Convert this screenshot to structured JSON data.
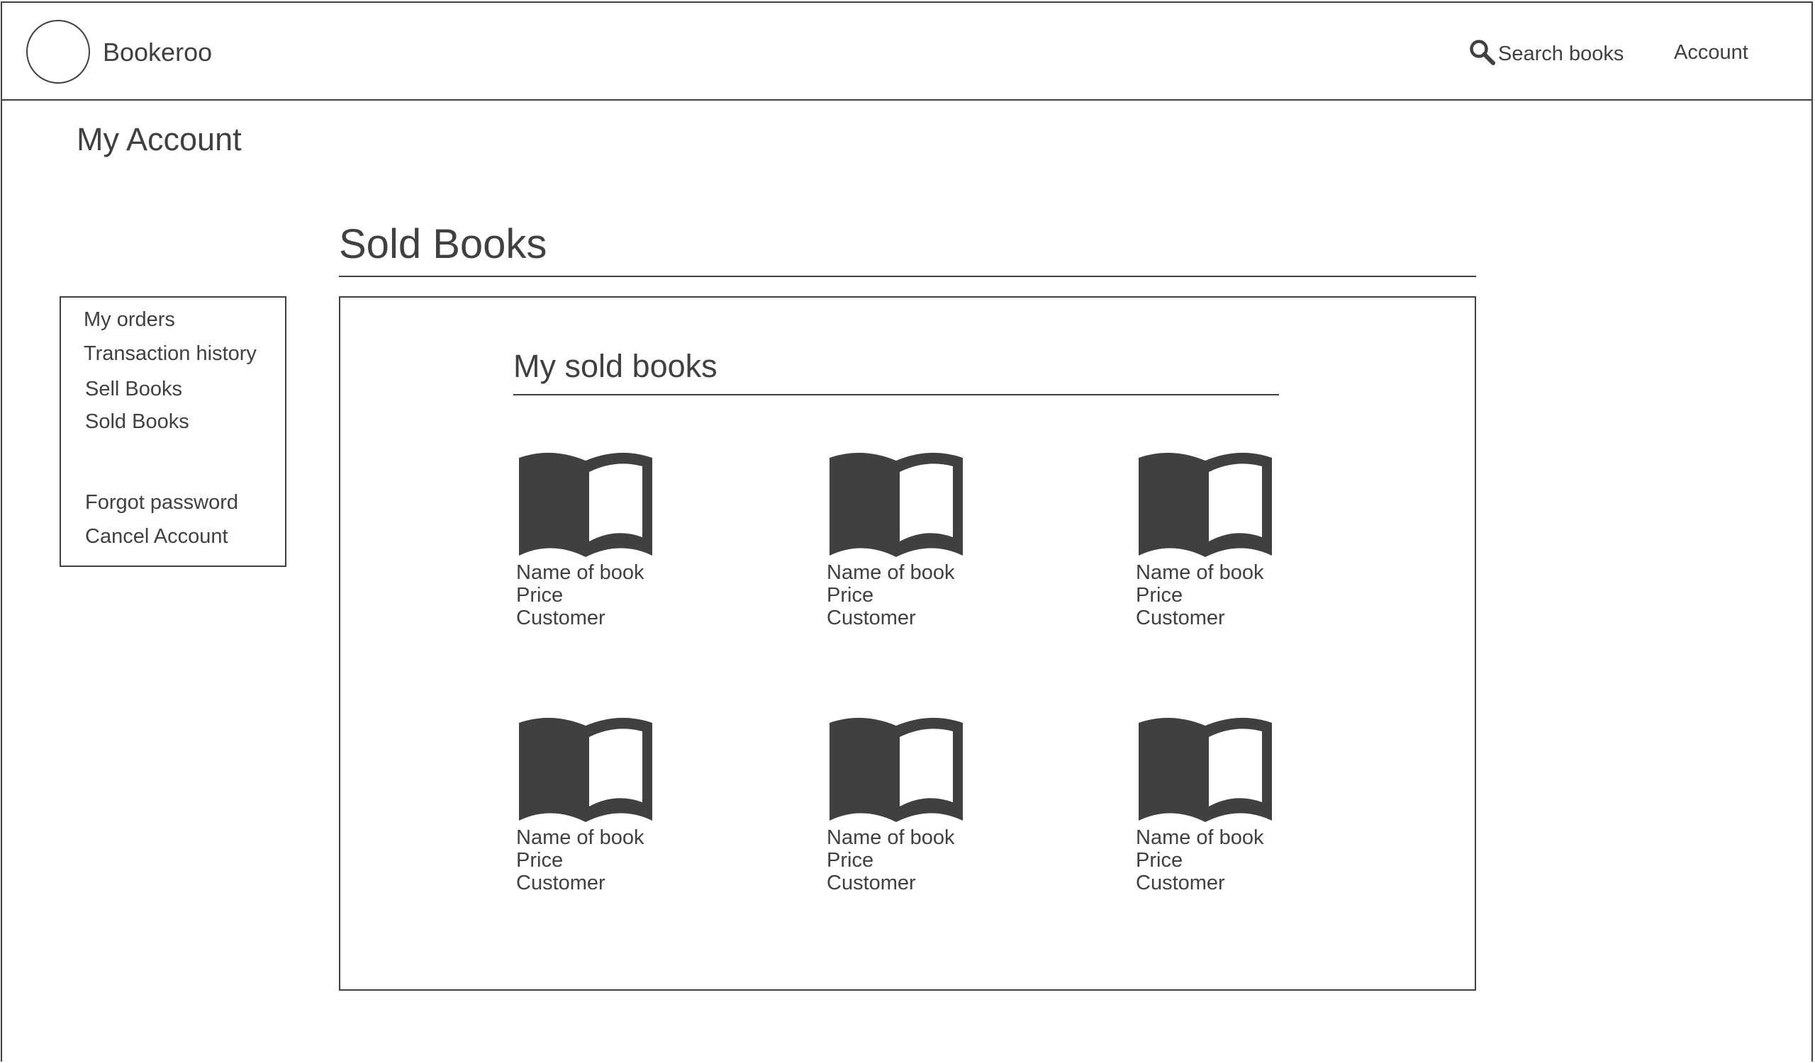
{
  "header": {
    "brand": "Bookeroo",
    "search_label": "Search books",
    "account_label": "Account"
  },
  "page": {
    "title": "My Account",
    "section_title": "Sold Books"
  },
  "sidebar": {
    "items": [
      {
        "label": "My orders"
      },
      {
        "label": "Transaction history"
      },
      {
        "label": "Sell Books"
      },
      {
        "label": "Sold Books"
      },
      {
        "label": "Forgot password"
      },
      {
        "label": "Cancel Account"
      }
    ]
  },
  "content": {
    "subtitle": "My sold books",
    "books": [
      {
        "name": "Name of book",
        "price": "Price",
        "customer": "Customer"
      },
      {
        "name": "Name of book",
        "price": "Price",
        "customer": "Customer"
      },
      {
        "name": "Name of book",
        "price": "Price",
        "customer": "Customer"
      },
      {
        "name": "Name of book",
        "price": "Price",
        "customer": "Customer"
      },
      {
        "name": "Name of book",
        "price": "Price",
        "customer": "Customer"
      },
      {
        "name": "Name of book",
        "price": "Price",
        "customer": "Customer"
      }
    ]
  },
  "icons": {
    "logo": "logo-circle",
    "search": "magnifier-icon",
    "book": "open-book-icon"
  },
  "colors": {
    "ink": "#404040",
    "background": "#ffffff"
  }
}
